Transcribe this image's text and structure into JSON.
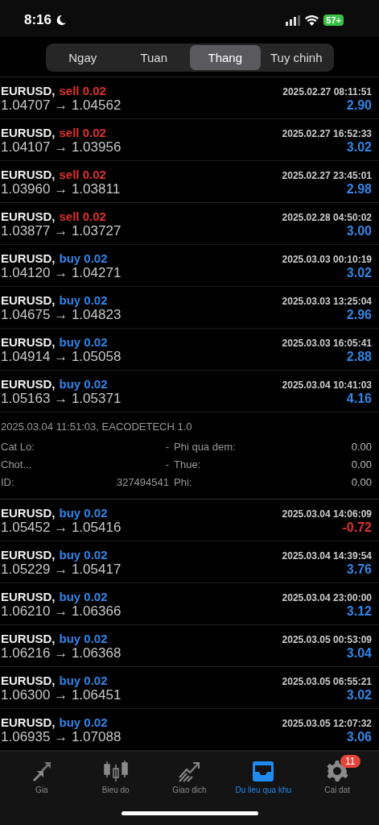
{
  "status_bar": {
    "time": "8:16",
    "battery": "57+"
  },
  "period_tabs": [
    {
      "label": "Ngay",
      "selected": false
    },
    {
      "label": "Tuan",
      "selected": false
    },
    {
      "label": "Thang",
      "selected": true
    },
    {
      "label": "Tuy chinh",
      "selected": false
    }
  ],
  "trades_top": [
    {
      "symbol": "EURUSD,",
      "kind": "sell",
      "order": "sell 0.02",
      "time": "2025.02.27 08:11:51",
      "prices": "1.04707 → 1.04562",
      "profit": "2.90",
      "loss": false
    },
    {
      "symbol": "EURUSD,",
      "kind": "sell",
      "order": "sell 0.02",
      "time": "2025.02.27 16:52:33",
      "prices": "1.04107 → 1.03956",
      "profit": "3.02",
      "loss": false
    },
    {
      "symbol": "EURUSD,",
      "kind": "sell",
      "order": "sell 0.02",
      "time": "2025.02.27 23:45:01",
      "prices": "1.03960 → 1.03811",
      "profit": "2.98",
      "loss": false
    },
    {
      "symbol": "EURUSD,",
      "kind": "sell",
      "order": "sell 0.02",
      "time": "2025.02.28 04:50:02",
      "prices": "1.03877 → 1.03727",
      "profit": "3.00",
      "loss": false
    },
    {
      "symbol": "EURUSD,",
      "kind": "buy",
      "order": "buy 0.02",
      "time": "2025.03.03 00:10:19",
      "prices": "1.04120 → 1.04271",
      "profit": "3.02",
      "loss": false
    },
    {
      "symbol": "EURUSD,",
      "kind": "buy",
      "order": "buy 0.02",
      "time": "2025.03.03 13:25:04",
      "prices": "1.04675 → 1.04823",
      "profit": "2.96",
      "loss": false
    },
    {
      "symbol": "EURUSD,",
      "kind": "buy",
      "order": "buy 0.02",
      "time": "2025.03.03 16:05:41",
      "prices": "1.04914 → 1.05058",
      "profit": "2.88",
      "loss": false
    },
    {
      "symbol": "EURUSD,",
      "kind": "buy",
      "order": "buy 0.02",
      "time": "2025.03.04 10:41:03",
      "prices": "1.05163 → 1.05371",
      "profit": "4.16",
      "loss": false
    }
  ],
  "trade_details": {
    "header": "2025.03.04 11:51:03, EACODETECH 1.0",
    "left": [
      {
        "label": "Cat Lo:",
        "value": "-"
      },
      {
        "label": "Chot...",
        "value": "-"
      },
      {
        "label": "ID:",
        "value": "327494541"
      }
    ],
    "right": [
      {
        "label": "Phi qua dem:",
        "value": "0.00"
      },
      {
        "label": "Thue:",
        "value": "0.00"
      },
      {
        "label": "Phi:",
        "value": "0.00"
      }
    ]
  },
  "trades_bottom": [
    {
      "symbol": "EURUSD,",
      "kind": "buy",
      "order": "buy 0.02",
      "time": "2025.03.04 14:06:09",
      "prices": "1.05452 → 1.05416",
      "profit": "-0.72",
      "loss": true
    },
    {
      "symbol": "EURUSD,",
      "kind": "buy",
      "order": "buy 0.02",
      "time": "2025.03.04 14:39:54",
      "prices": "1.05229 → 1.05417",
      "profit": "3.76",
      "loss": false
    },
    {
      "symbol": "EURUSD,",
      "kind": "buy",
      "order": "buy 0.02",
      "time": "2025.03.04 23:00:00",
      "prices": "1.06210 → 1.06366",
      "profit": "3.12",
      "loss": false
    },
    {
      "symbol": "EURUSD,",
      "kind": "buy",
      "order": "buy 0.02",
      "time": "2025.03.05 00:53:09",
      "prices": "1.06216 → 1.06368",
      "profit": "3.04",
      "loss": false
    },
    {
      "symbol": "EURUSD,",
      "kind": "buy",
      "order": "buy 0.02",
      "time": "2025.03.05 06:55:21",
      "prices": "1.06300 → 1.06451",
      "profit": "3.02",
      "loss": false
    },
    {
      "symbol": "EURUSD,",
      "kind": "buy",
      "order": "buy 0.02",
      "time": "2025.03.05 12:07:32",
      "prices": "1.06935 → 1.07088",
      "profit": "3.06",
      "loss": false
    }
  ],
  "tab_bar": [
    {
      "kind": "quotes",
      "label": "Gia",
      "selected": false
    },
    {
      "kind": "chart",
      "label": "Bieu do",
      "selected": false
    },
    {
      "kind": "trade",
      "label": "Giao dich",
      "selected": false
    },
    {
      "kind": "history",
      "label": "Du lieu qua khu",
      "selected": true
    },
    {
      "kind": "settings",
      "label": "Cai dat",
      "selected": false,
      "badge": "11"
    }
  ]
}
